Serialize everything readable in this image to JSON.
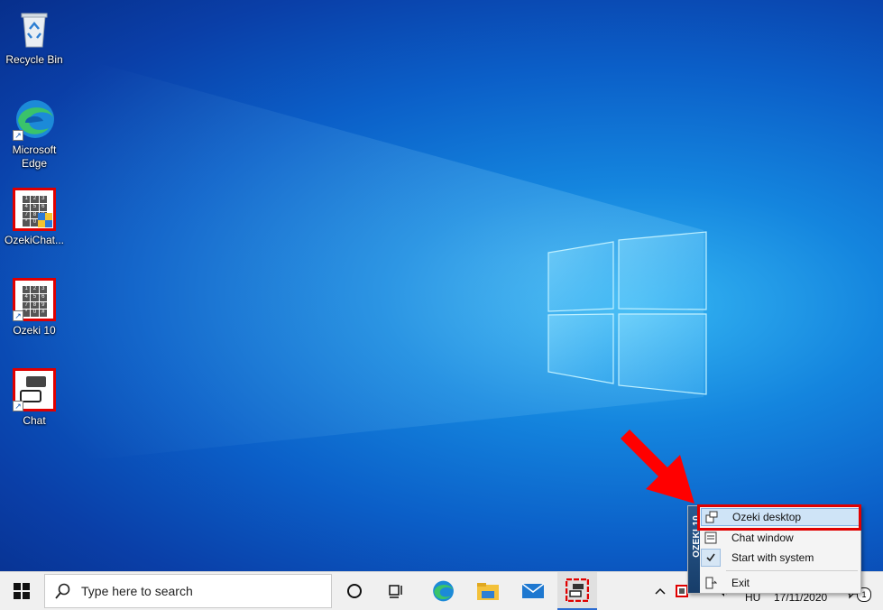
{
  "desktop": {
    "icons": [
      {
        "label": "Recycle Bin",
        "icon": "recycle-bin-icon"
      },
      {
        "label": "Microsoft\nEdge",
        "icon": "edge-icon"
      },
      {
        "label": "OzekiChat...",
        "icon": "ozeki-chat-installer-icon"
      },
      {
        "label": "Ozeki 10",
        "icon": "ozeki-10-icon"
      },
      {
        "label": "Chat",
        "icon": "chat-icon"
      }
    ]
  },
  "taskbar": {
    "search_placeholder": "Type here to search",
    "pinned": [
      "task-view-icon",
      "edge-icon",
      "file-explorer-icon",
      "mail-icon",
      "ozeki-chat-icon"
    ],
    "tray": {
      "language": "HU",
      "date": "17/11/2020",
      "notification_count": "1"
    }
  },
  "context_menu": {
    "side_label": "OZEKI 10",
    "items": [
      {
        "label": "Ozeki desktop",
        "highlighted": true
      },
      {
        "label": "Chat window"
      },
      {
        "label": "Start with system",
        "checked": true
      },
      {
        "label": "Exit"
      }
    ]
  },
  "colors": {
    "accent_red": "#e00000",
    "menu_highlight": "#cfe4f7",
    "taskbar": "#f0f0f0"
  }
}
